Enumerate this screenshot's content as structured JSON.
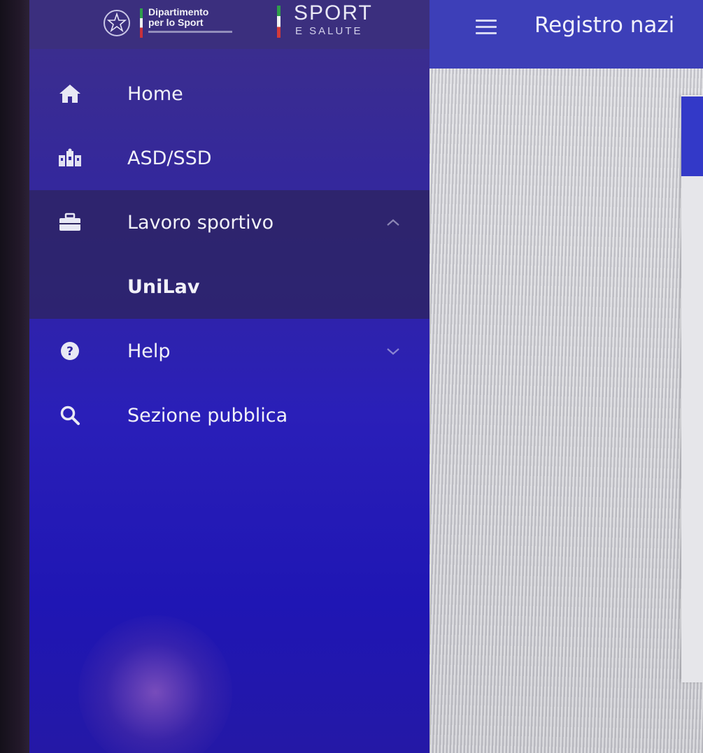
{
  "branding": {
    "department_line1": "Dipartimento",
    "department_line2": "per lo Sport",
    "sport_title": "SPORT",
    "sport_subtitle": "E SALUTE"
  },
  "header": {
    "title": "Registro nazi"
  },
  "sidebar": {
    "items": [
      {
        "label": "Home",
        "icon": "home-icon"
      },
      {
        "label": "ASD/SSD",
        "icon": "sports-group-icon"
      },
      {
        "label": "Lavoro sportivo",
        "icon": "briefcase-icon",
        "expanded": true
      },
      {
        "label": "UniLav",
        "icon": "",
        "sub_item": true
      },
      {
        "label": "Help",
        "icon": "help-icon",
        "expanded": false
      },
      {
        "label": "Sezione pubblica",
        "icon": "search-icon"
      }
    ]
  },
  "colors": {
    "sidebar": "#2a1fb8",
    "header": "#3d3fb8",
    "active_item": "#2d2460",
    "accent_card": "#3339c8"
  }
}
